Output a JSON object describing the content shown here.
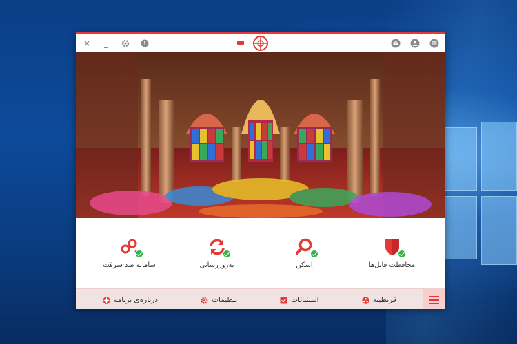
{
  "app": {
    "colors": {
      "accent": "#e53935",
      "success": "#2fb34a",
      "bottom_bar": "#f2e3e3"
    },
    "titlebar": {
      "left_icons": [
        "close-icon",
        "minimize-icon",
        "gear-icon",
        "info-icon"
      ],
      "close_label": "×",
      "minimize_label": "_",
      "info_label": "!",
      "right_icons": [
        "mail-icon",
        "user-icon",
        "hamburger-menu-icon"
      ],
      "center_icons": [
        "battery-icon",
        "app-logo-crosshair-icon"
      ]
    },
    "hero": {
      "icon": "mosque-stained-glass-image"
    },
    "features": [
      {
        "label": "محافظت فایل‌ها",
        "icon": "shield-icon",
        "status": "ok"
      },
      {
        "label": "اِسکن",
        "icon": "magnifier-icon",
        "status": "ok"
      },
      {
        "label": "به‌روزرسانی",
        "icon": "refresh-icon",
        "status": "ok"
      },
      {
        "label": "سامانه ضد سرقت",
        "icon": "anti-theft-icon",
        "status": "ok"
      }
    ],
    "bottom_nav": [
      {
        "label": "قرنطینه",
        "icon": "quarantine-icon"
      },
      {
        "label": "استثنائات",
        "icon": "exceptions-icon"
      },
      {
        "label": "تنظیمات",
        "icon": "settings-icon"
      },
      {
        "label": "درباره‌ی برنامه",
        "icon": "about-icon"
      }
    ],
    "menu_icon": "hamburger-menu-icon"
  },
  "desktop": {
    "background": "windows-10-wallpaper"
  }
}
